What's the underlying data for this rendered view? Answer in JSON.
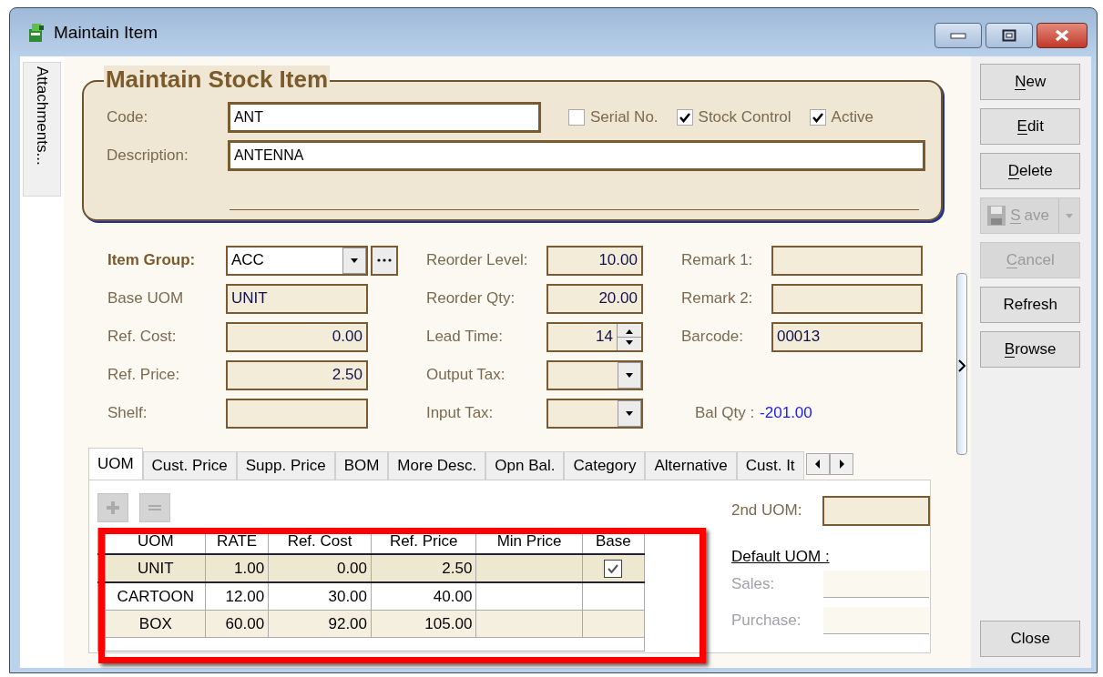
{
  "window": {
    "title": "Maintain Item"
  },
  "side_tab": {
    "label": "Attachments..."
  },
  "header": {
    "title": "Maintain Stock Item",
    "code": {
      "label": "Code:",
      "value": "ANT"
    },
    "description": {
      "label": "Description:",
      "value": "ANTENNA"
    },
    "checks": [
      {
        "label": "Serial No.",
        "checked": false
      },
      {
        "label": "Stock Control",
        "checked": true
      },
      {
        "label": "Active",
        "checked": true
      }
    ]
  },
  "fields": [
    [
      {
        "kind": "combo",
        "label": "Item Group:",
        "value": "ACC",
        "required": true
      },
      {
        "kind": "text",
        "label": "Base UOM",
        "value": "UNIT",
        "required": false
      },
      {
        "kind": "number",
        "label": "Ref. Cost:",
        "value": "0.00",
        "required": false
      },
      {
        "kind": "number",
        "label": "Ref. Price:",
        "value": "2.50",
        "required": false
      },
      {
        "kind": "text",
        "label": "Shelf:",
        "required": false
      }
    ],
    [
      {
        "kind": "number",
        "label": "Reorder Level:",
        "value": "10.00",
        "required": false
      },
      {
        "kind": "number",
        "label": "Reorder Qty:",
        "value": "20.00",
        "required": false
      },
      {
        "kind": "spin",
        "label": "Lead Time:",
        "value": "14",
        "required": false
      },
      {
        "kind": "combo",
        "label": "Output Tax:",
        "required": false
      },
      {
        "kind": "combo",
        "label": "Input Tax:",
        "required": false
      }
    ],
    [
      {
        "kind": "text",
        "label": "Remark 1:",
        "required": false
      },
      {
        "kind": "text",
        "label": "Remark 2:",
        "required": false
      },
      {
        "kind": "text",
        "label": "Barcode:",
        "value": "00013",
        "required": false
      }
    ]
  ],
  "bal_qty": {
    "label": "Bal Qty :",
    "value": "-201.00"
  },
  "tabs": [
    {
      "label": "UOM",
      "selected": true
    },
    {
      "label": "Cust. Price",
      "selected": false
    },
    {
      "label": "Supp. Price",
      "selected": false
    },
    {
      "label": "BOM",
      "selected": false
    },
    {
      "label": "More Desc.",
      "selected": false
    },
    {
      "label": "Opn Bal.",
      "selected": false
    },
    {
      "label": "Category",
      "selected": false
    },
    {
      "label": "Alternative",
      "selected": false
    },
    {
      "label": "Cust. It",
      "selected": false
    }
  ],
  "uom_table": {
    "columns": [
      "UOM",
      "RATE",
      "Ref. Cost",
      "Ref. Price",
      "Min Price",
      "Base"
    ],
    "rows": [
      {
        "cells": [
          "UNIT",
          "1.00",
          "0.00",
          "2.50",
          ""
        ],
        "base": true,
        "selected": true
      },
      {
        "cells": [
          "CARTOON",
          "12.00",
          "30.00",
          "40.00",
          ""
        ],
        "base": false,
        "selected": false
      },
      {
        "cells": [
          "BOX",
          "60.00",
          "92.00",
          "105.00",
          ""
        ],
        "base": false,
        "selected": false
      }
    ]
  },
  "second_uom": {
    "label": "2nd UOM:"
  },
  "default_uom": {
    "title": "Default UOM :",
    "fields": [
      {
        "label": "Sales:",
        "disabled": true
      },
      {
        "label": "Purchase:",
        "disabled": true
      }
    ]
  },
  "buttons": [
    {
      "kind": "button",
      "label": "New",
      "disabled": false,
      "mnemonic_underlined": true
    },
    {
      "kind": "button",
      "label": "Edit",
      "disabled": false,
      "mnemonic_underlined": true
    },
    {
      "kind": "button",
      "label": "Delete",
      "disabled": false,
      "mnemonic_underlined": true
    },
    {
      "kind": "split",
      "label": "Save",
      "disabled": true,
      "mnemonic_underlined": true
    },
    {
      "kind": "button",
      "label": "Cancel",
      "disabled": true,
      "mnemonic_underlined": true
    },
    {
      "kind": "button",
      "label": "Refresh",
      "disabled": false,
      "mnemonic_underlined": false
    },
    {
      "kind": "button",
      "label": "Browse",
      "disabled": false,
      "mnemonic_underlined": true
    }
  ],
  "close_button": {
    "label": "Close"
  }
}
